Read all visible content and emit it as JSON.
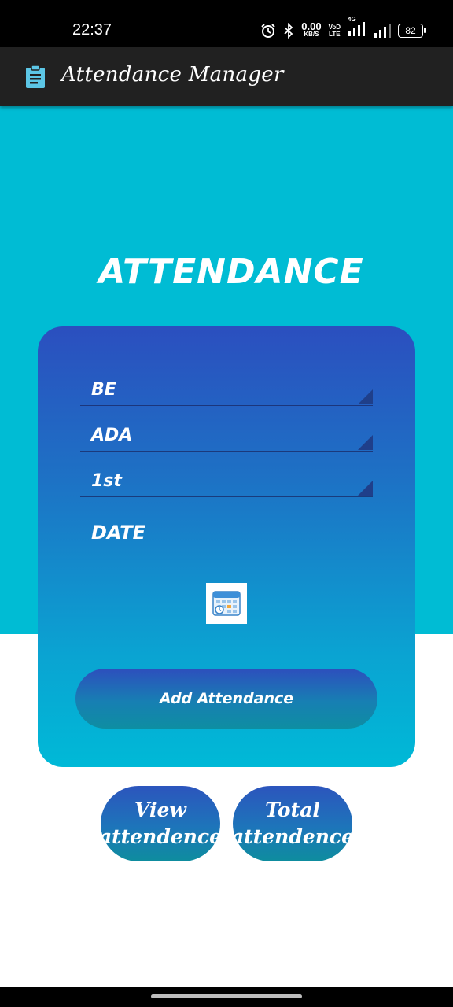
{
  "status_bar": {
    "time": "22:37",
    "net_speed": "0.00",
    "net_unit": "KB/S",
    "volte_top": "VoD",
    "volte_bottom": "LTE",
    "network_type": "4G",
    "battery": "82",
    "icons": [
      "alarm-icon",
      "bluetooth-icon",
      "signal-icon",
      "signal-icon",
      "battery-icon"
    ]
  },
  "app_bar": {
    "title": "Attendance Manager",
    "icon": "clipboard-icon"
  },
  "main": {
    "heading": "ATTENDANCE"
  },
  "form": {
    "course": "BE",
    "subject": "ADA",
    "semester": "1st",
    "date_label": "DATE",
    "calendar_icon": "calendar-icon",
    "add_button": "Add Attendance"
  },
  "buttons": {
    "view_line1": "View",
    "view_line2": "attendence",
    "total_line1": "Total",
    "total_line2": "attendence"
  },
  "colors": {
    "status_bar": "#000000",
    "app_bar": "#212121",
    "hero": "#00bcd4",
    "card_top": "#2b4fbf",
    "card_bottom": "#00b9d7",
    "text": "#ffffff"
  }
}
